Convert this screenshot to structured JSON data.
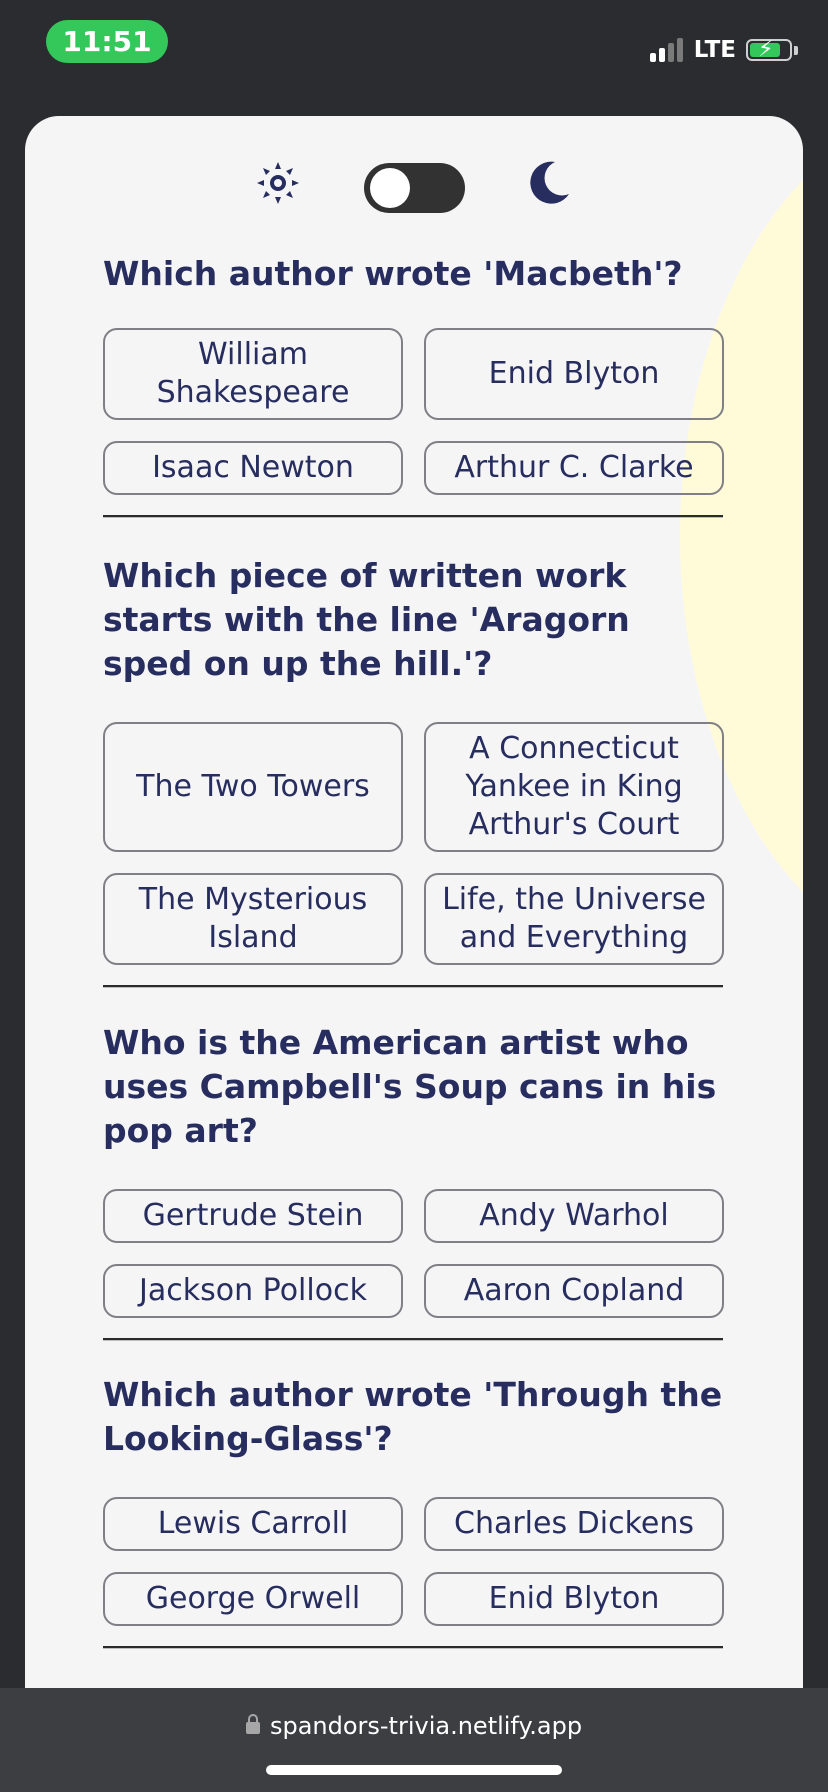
{
  "status_bar": {
    "time": "11:51",
    "network": "LTE",
    "signal_bars": 2,
    "charging": true
  },
  "theme_toggle": {
    "sun_icon": "sun-icon",
    "moon_icon": "moon-icon",
    "dark_mode": false
  },
  "colors": {
    "text": "#272e5f",
    "card": "#f5f5f6",
    "glow": "#fffbd8",
    "status_green": "#34c759"
  },
  "questions": [
    {
      "text": "Which author wrote 'Macbeth'?",
      "answers": [
        "William Shakespeare",
        "Enid Blyton",
        "Isaac Newton",
        "Arthur C. Clarke"
      ]
    },
    {
      "text": "Which piece of written work starts with the line 'Aragorn sped on up the hill.'?",
      "answers": [
        "The Two Towers",
        "A Connecticut Yankee in King Arthur's Court",
        "The Mysterious Island",
        "Life, the Universe and Everything"
      ]
    },
    {
      "text": "Who is the American artist who uses Campbell's Soup cans in his pop art?",
      "answers": [
        "Gertrude Stein",
        "Andy Warhol",
        "Jackson Pollock",
        "Aaron Copland"
      ]
    },
    {
      "text": "Which author wrote 'Through the Looking-Glass'?",
      "answers": [
        "Lewis Carroll",
        "Charles Dickens",
        "George Orwell",
        "Enid Blyton"
      ]
    }
  ],
  "browser": {
    "url": "spandors-trivia.netlify.app"
  }
}
